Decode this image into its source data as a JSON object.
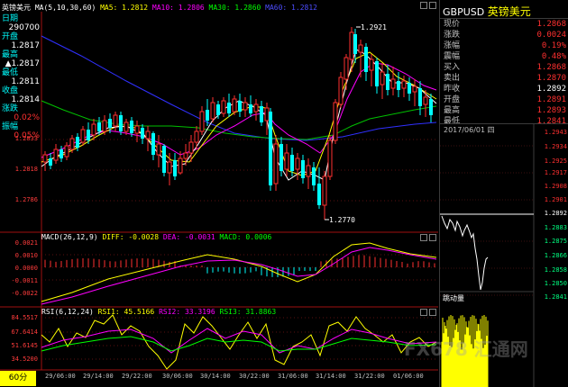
{
  "window": {
    "title": "英镑美元",
    "code": "GBPUSD",
    "name": "英镑美元"
  },
  "ma_header": {
    "params": "MA(5,10,30,60)",
    "ma5": "MA5: 1.2812",
    "ma10": "MA10: 1.2806",
    "ma30": "MA30: 1.2860",
    "ma60": "MA60: 1.2812"
  },
  "macd_header": {
    "params": "MACD(26,12,9)",
    "diff": "DIFF: -0.0028",
    "dea": "DEA: -0.0031",
    "macd": "MACD: 0.0006"
  },
  "rsi_header": {
    "params": "RSI(6,12,24)",
    "rsi1": "RSI1: 45.5166",
    "rsi2": "RSI2: 33.3196",
    "rsi3": "RSI3: 31.8863"
  },
  "left_info": {
    "date_label": "日期",
    "date_value": "290700",
    "open_label": "开盘",
    "open_value": "1.2817",
    "high_label": "最高",
    "high_value": "▲1.2817",
    "low_label": "最低",
    "low_value": "1.2811",
    "close_label": "收盘",
    "close_value": "1.2814",
    "change_label": "涨跌",
    "change_value": "0.02%",
    "amp_label": "振幅",
    "amp_value": "0.05%"
  },
  "price_axis": [
    "1.2833",
    "1.2818",
    "1.2786"
  ],
  "macd_axis": [
    "0.0021",
    "0.0010",
    "0.0000",
    "-0.0011",
    "-0.0022"
  ],
  "rsi_axis": [
    "84.5517",
    "67.6414",
    "51.6145",
    "34.5200"
  ],
  "annotations": {
    "high": "1.2921",
    "low": "1.2770"
  },
  "period": "60分",
  "time_labels": [
    "29/06:00",
    "29/14:00",
    "29/22:00",
    "30/06:00",
    "30/14:00",
    "30/22:00",
    "31/06:00",
    "31/14:00",
    "31/22:00",
    "01/06:00"
  ],
  "quote": {
    "rows": [
      {
        "label": "现价",
        "value": "1.2868",
        "color": "#ff3030"
      },
      {
        "label": "涨跌",
        "value": "0.0024",
        "color": "#ff3030"
      },
      {
        "label": "涨幅",
        "value": "0.19%",
        "color": "#ff3030"
      },
      {
        "label": "震幅",
        "value": "0.48%",
        "color": "#ff3030"
      },
      {
        "label": "买入",
        "value": "1.2868",
        "color": "#ff3030"
      },
      {
        "label": "卖出",
        "value": "1.2870",
        "color": "#ff3030"
      },
      {
        "label": "昨收",
        "value": "1.2892",
        "color": "#ffffff"
      },
      {
        "label": "开盘",
        "value": "1.2891",
        "color": "#ff3030"
      },
      {
        "label": "最高",
        "value": "1.2893",
        "color": "#ff3030"
      },
      {
        "label": "最低",
        "value": "1.2841",
        "color": "#ff3030"
      }
    ]
  },
  "mini_chart": {
    "date": "2017/06/01 四",
    "levels": [
      "1.2943",
      "1.2934",
      "1.2925",
      "1.2917",
      "1.2908",
      "1.2901",
      "1.2892",
      "1.2883",
      "1.2875",
      "1.2866",
      "1.2858",
      "1.2850",
      "1.2841"
    ],
    "volume_label": "跳动量"
  },
  "watermark": "FX678 汇通网",
  "colors": {
    "up": "#ff3030",
    "down": "#00ffff",
    "ma5": "#ffffff",
    "ma10": "#ffff00",
    "ma30": "#ff00ff",
    "ma60": "#00ff00",
    "ma90": "#3030ff"
  }
}
